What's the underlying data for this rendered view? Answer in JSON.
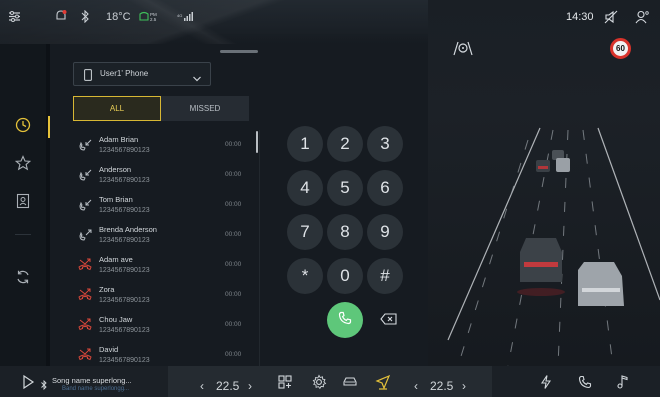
{
  "status": {
    "temperature": "18°C",
    "time": "14:30"
  },
  "phone": {
    "selected_phone": "User1' Phone",
    "tabs": [
      {
        "label": "ALL",
        "active": true
      },
      {
        "label": "MISSED",
        "active": false
      }
    ]
  },
  "calls": [
    {
      "name": "Adam Brian",
      "number": "1234567890123",
      "time": "00:00",
      "missed": false
    },
    {
      "name": "Anderson",
      "number": "1234567890123",
      "time": "00:00",
      "missed": false
    },
    {
      "name": "Tom Brian",
      "number": "1234567890123",
      "time": "00:00",
      "missed": false
    },
    {
      "name": "Brenda Anderson",
      "number": "1234567890123",
      "time": "00:00",
      "missed": false
    },
    {
      "name": "Adam ave",
      "number": "1234567890123",
      "time": "00:00",
      "missed": true
    },
    {
      "name": "Zora",
      "number": "1234567890123",
      "time": "00:00",
      "missed": true
    },
    {
      "name": "Chou Jaw",
      "number": "1234567890123",
      "time": "00:00",
      "missed": true
    },
    {
      "name": "David",
      "number": "1234567890123",
      "time": "00:00",
      "missed": true
    }
  ],
  "dialpad": [
    "1",
    "2",
    "3",
    "4",
    "5",
    "6",
    "7",
    "8",
    "9",
    "*",
    "0",
    "#"
  ],
  "driving": {
    "speed_limit": "60"
  },
  "dock": {
    "song_title": "Song name superlong...",
    "song_subtitle": "Band name superlongg...",
    "temp_left": "22.5",
    "temp_right": "22.5",
    "temp_left_dec": "‹",
    "temp_left_inc": "›",
    "temp_right_dec": "‹",
    "temp_right_inc": "›"
  },
  "colors": {
    "accent": "#e5c23a",
    "call_green": "#5ec77a",
    "missed_red": "#d9483b"
  }
}
